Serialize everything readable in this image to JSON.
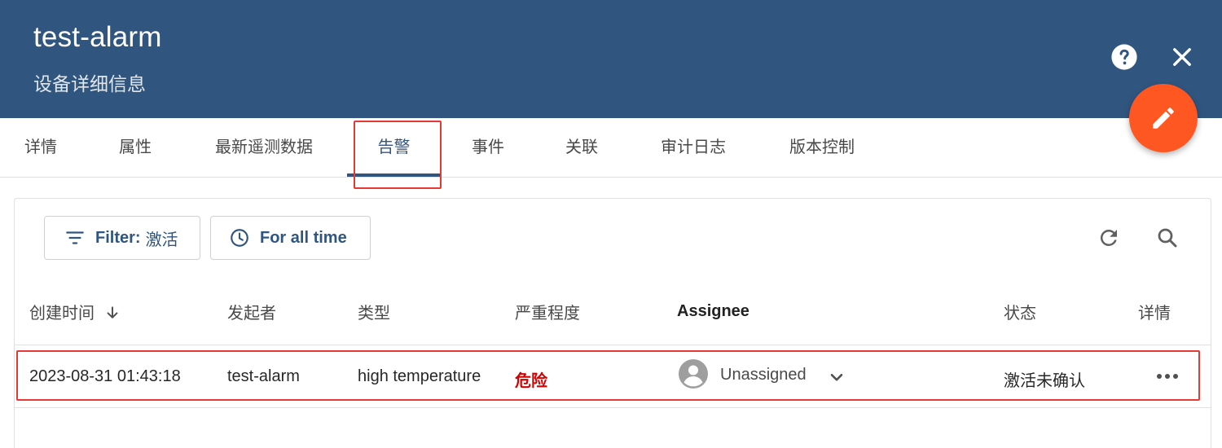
{
  "header": {
    "title": "test-alarm",
    "subtitle": "设备详细信息",
    "bg_color": "#305680",
    "help_icon": "help-circle-icon",
    "close_icon": "close-icon"
  },
  "fab": {
    "icon": "pencil-icon",
    "color": "#ff5722"
  },
  "tabs": [
    {
      "label": "详情"
    },
    {
      "label": "属性"
    },
    {
      "label": "最新遥测数据"
    },
    {
      "label": "告警",
      "active": true
    },
    {
      "label": "事件"
    },
    {
      "label": "关联"
    },
    {
      "label": "审计日志"
    },
    {
      "label": "版本控制"
    }
  ],
  "toolbar": {
    "filter_label": "Filter:",
    "filter_value": "激活",
    "time_label": "For all time",
    "refresh_icon": "refresh-icon",
    "search_icon": "search-icon"
  },
  "table": {
    "columns": [
      "创建时间",
      "发起者",
      "类型",
      "严重程度",
      "Assignee",
      "状态",
      "详情"
    ],
    "sort_column": "创建时间",
    "sort_direction": "desc",
    "rows": [
      {
        "created": "2023-08-31 01:43:18",
        "originator": "test-alarm",
        "type": "high temperature",
        "severity": "危险",
        "assignee": "Unassigned",
        "status": "激活未确认"
      }
    ]
  },
  "colors": {
    "primary": "#305680",
    "severity_critical": "#d50000",
    "highlight_box": "#e53935"
  }
}
